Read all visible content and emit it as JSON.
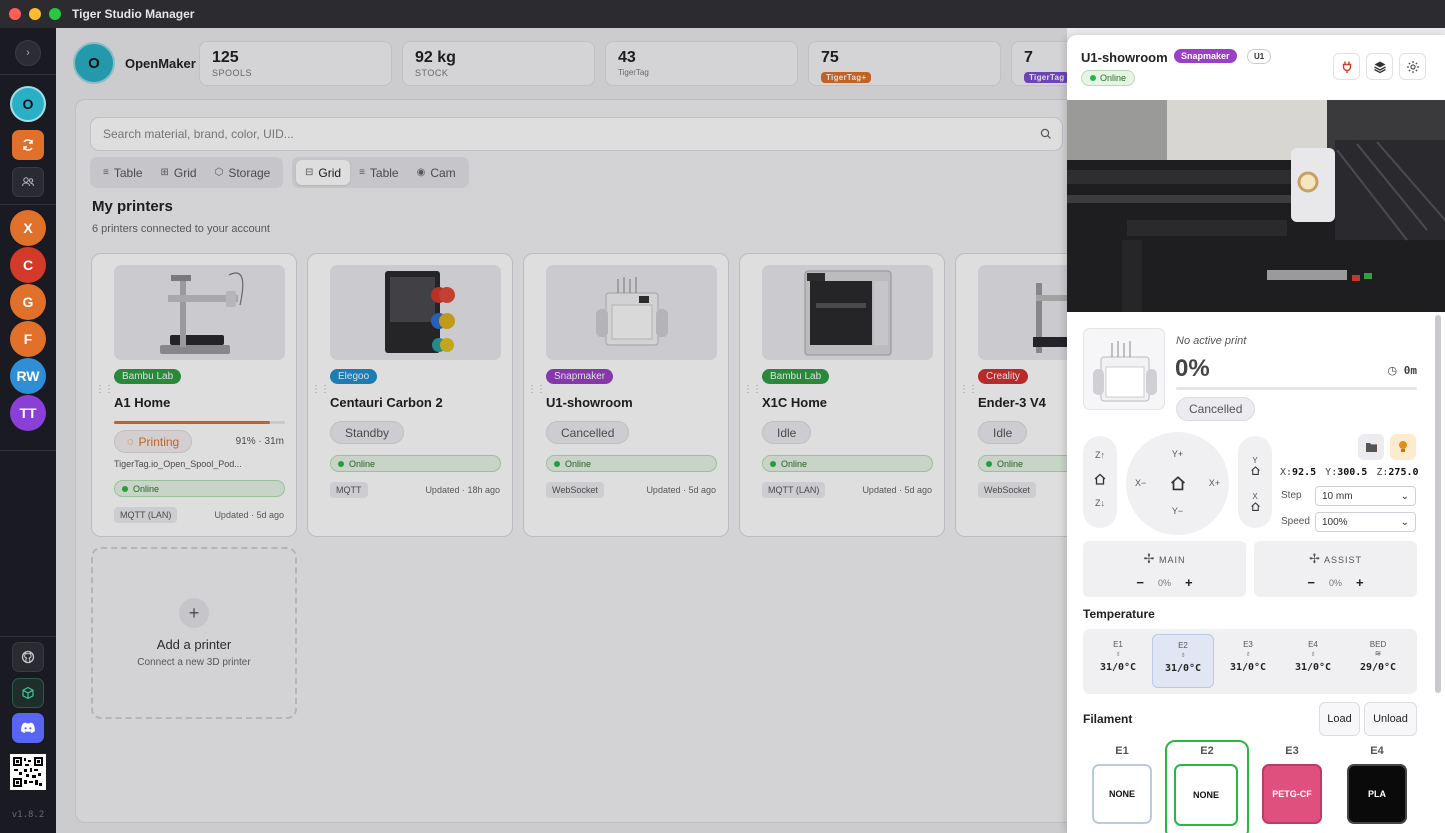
{
  "window": {
    "title": "Tiger Studio Manager"
  },
  "sidebar": {
    "users": [
      {
        "initials": "O",
        "color": "#2ab0c6"
      },
      {
        "initials": "X",
        "color": "#e0702a"
      },
      {
        "initials": "C",
        "color": "#d33a2a"
      },
      {
        "initials": "G",
        "color": "#e0702a"
      },
      {
        "initials": "F",
        "color": "#e0702a"
      },
      {
        "initials": "RW",
        "color": "#2e8fd6"
      },
      {
        "initials": "TT",
        "color": "#8a3fd6"
      }
    ],
    "version": "v1.8.2"
  },
  "profile": {
    "initial": "O",
    "name": "OpenMaker"
  },
  "stats": [
    {
      "value": "125",
      "label": "SPOOLS"
    },
    {
      "value": "92 kg",
      "label": "STOCK"
    },
    {
      "value": "43",
      "label": "TigerTag"
    },
    {
      "value": "75",
      "label": "TigerTag+"
    },
    {
      "value": "7",
      "label": "TigerTag"
    }
  ],
  "search": {
    "placeholder": "Search material, brand, color, UID..."
  },
  "view_tabs": {
    "group1": [
      "Table",
      "Grid",
      "Storage"
    ],
    "group2": [
      "Grid",
      "Table",
      "Cam"
    ]
  },
  "printers_section": {
    "title": "My printers",
    "subtitle": "6 printers connected to your account"
  },
  "printers": [
    {
      "brand": "Bambu Lab",
      "brand_color": "#2f9e44",
      "name": "A1 Home",
      "status": "Printing",
      "progress_text": "91% · 31m",
      "progress": 0.91,
      "file": "TigerTag.io_Open_Spool_Pod...",
      "online": "Online",
      "conn": "MQTT (LAN)",
      "updated": "Updated · 5d ago"
    },
    {
      "brand": "Elegoo",
      "brand_color": "#1f8fd1",
      "name": "Centauri Carbon 2",
      "status": "Standby",
      "online": "Online",
      "conn": "MQTT",
      "updated": "Updated · 18h ago"
    },
    {
      "brand": "Snapmaker",
      "brand_color": "#9b3fc6",
      "name": "U1-showroom",
      "status": "Cancelled",
      "online": "Online",
      "conn": "WebSocket",
      "updated": "Updated · 5d ago"
    },
    {
      "brand": "Bambu Lab",
      "brand_color": "#2f9e44",
      "name": "X1C Home",
      "status": "Idle",
      "online": "Online",
      "conn": "MQTT (LAN)",
      "updated": "Updated · 5d ago"
    },
    {
      "brand": "Creality",
      "brand_color": "#d63030",
      "name": "Ender-3 V4",
      "status": "Idle",
      "online": "Online",
      "conn": "WebSocket",
      "updated": ""
    }
  ],
  "add_printer": {
    "title": "Add a printer",
    "subtitle": "Connect a new 3D printer"
  },
  "panel": {
    "name": "U1-showroom",
    "brand": "Snapmaker",
    "model": "U1",
    "online": "Online",
    "print": {
      "state": "No active print",
      "percent": "0%",
      "time": "0m",
      "status": "Cancelled",
      "progress": 0
    },
    "jog": {
      "z_up": "Z↑",
      "z_down": "Z↓",
      "y_plus": "Y+",
      "y_minus": "Y−",
      "x_minus": "X−",
      "x_plus": "X+",
      "y_home": "Y",
      "x_home": "X"
    },
    "position": {
      "x_label": "X:",
      "x": "92.5",
      "y_label": "Y:",
      "y": "300.5",
      "z_label": "Z:",
      "z": "275.0"
    },
    "step": {
      "label": "Step",
      "value": "10 mm"
    },
    "speed": {
      "label": "Speed",
      "value": "100%"
    },
    "fans": [
      {
        "label": "MAIN",
        "value": "0%"
      },
      {
        "label": "ASSIST",
        "value": "0%"
      }
    ],
    "temperature": {
      "title": "Temperature",
      "items": [
        {
          "label": "E1",
          "value": "31/0°C"
        },
        {
          "label": "E2",
          "value": "31/0°C"
        },
        {
          "label": "E3",
          "value": "31/0°C"
        },
        {
          "label": "E4",
          "value": "31/0°C"
        },
        {
          "label": "BED",
          "value": "29/0°C"
        }
      ]
    },
    "filament": {
      "title": "Filament",
      "load": "Load",
      "unload": "Unload",
      "slots": [
        {
          "label": "E1",
          "material": "NONE",
          "color": "#ffffff",
          "text_color": "#111111"
        },
        {
          "label": "E2",
          "material": "NONE",
          "color": "#ffffff",
          "text_color": "#111111"
        },
        {
          "label": "E3",
          "material": "PETG-CF",
          "color": "#e0507f",
          "text_color": "#ffffff"
        },
        {
          "label": "E4",
          "material": "PLA",
          "color": "#0a0a0a",
          "text_color": "#ffffff"
        }
      ]
    }
  }
}
